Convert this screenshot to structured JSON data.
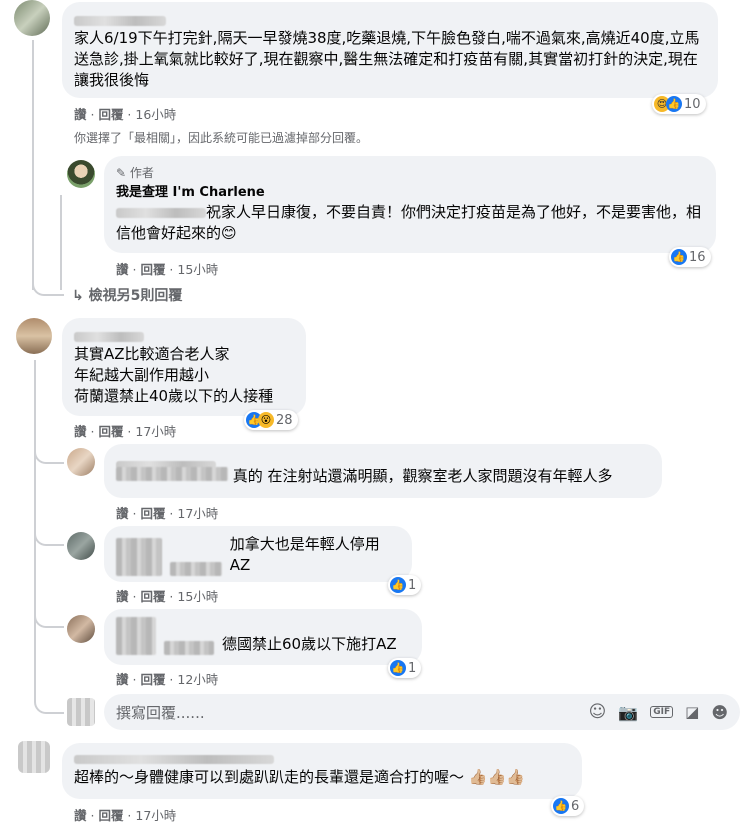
{
  "comment1": {
    "text": "家人6/19下午打完針,隔天一早發燒38度,吃藥退燒,下午臉色發白,喘不過氣來,高燒近40度,立馬送急診,掛上氧氣就比較好了,現在觀察中,醫生無法確定和打疫苗有關,其實當初打針的決定,現在讓我很後悔",
    "like_label": "讚",
    "reply_label": "回覆",
    "time": "16小時",
    "reaction_count": "10"
  },
  "filter_notice": "你選擇了「最相關」，因此系統可能已過濾掉部分回覆。",
  "author_reply": {
    "badge": "作者",
    "name": "我是查理 I'm Charlene",
    "text": "祝家人早日康復，不要自責！你們決定打疫苗是為了他好，不是要害他，相信他會好起來的",
    "like_label": "讚",
    "reply_label": "回覆",
    "time": "15小時",
    "reaction_count": "16"
  },
  "more_replies": "檢視另5則回覆",
  "comment2": {
    "line1": "其實AZ比較適合老人家",
    "line2": "年紀越大副作用越小",
    "line3": "荷蘭還禁止40歲以下的人接種",
    "like_label": "讚",
    "reply_label": "回覆",
    "time": "17小時",
    "reaction_count": "28"
  },
  "reply2a": {
    "text": "真的 在注射站還滿明顯，觀察室老人家問題沒有年輕人多",
    "like_label": "讚",
    "reply_label": "回覆",
    "time": "17小時"
  },
  "reply2b": {
    "text": "加拿大也是年輕人停用AZ",
    "like_label": "讚",
    "reply_label": "回覆",
    "time": "15小時",
    "reaction_count": "1"
  },
  "reply2c": {
    "text": "德國禁止60歲以下施打AZ",
    "like_label": "讚",
    "reply_label": "回覆",
    "time": "12小時",
    "reaction_count": "1"
  },
  "compose": {
    "placeholder": "撰寫回覆......"
  },
  "comment3": {
    "text": "超棒的～身體健康可以到處趴趴走的長輩還是適合打的喔～",
    "emoji": "👍🏼👍🏼👍🏼",
    "like_label": "讚",
    "reply_label": "回覆",
    "time": "17小時",
    "reaction_count": "6"
  },
  "colors": {
    "bubble": "#f0f2f5",
    "like_blue": "#1877f2",
    "meta_gray": "#65676b"
  }
}
